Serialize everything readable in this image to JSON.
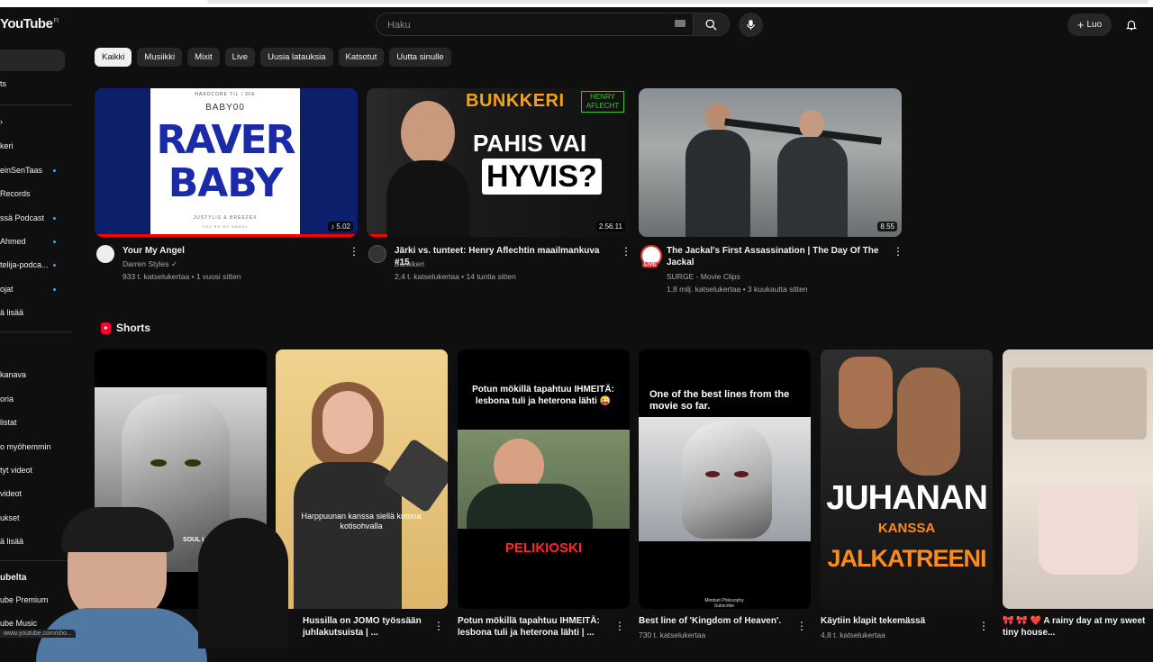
{
  "app": {
    "logo": "YouTube",
    "region": "FI"
  },
  "search": {
    "placeholder": "Haku",
    "value": ""
  },
  "header": {
    "create_label": "Luo"
  },
  "sidebar": {
    "items": [
      {
        "label": "ts"
      },
      {
        "label": "keri"
      },
      {
        "label": "einSenTaas"
      },
      {
        "label": "Records"
      },
      {
        "label": "ssä Podcast"
      },
      {
        "label": "Ahmed"
      },
      {
        "label": "telija-podca..."
      },
      {
        "label": "ojat"
      },
      {
        "label": "ä lisää"
      },
      {
        "label": "kanava"
      },
      {
        "label": "oria"
      },
      {
        "label": "listat"
      },
      {
        "label": "o myöhemmin"
      },
      {
        "label": "tyt videot"
      },
      {
        "label": "videot"
      },
      {
        "label": "ukset"
      },
      {
        "label": "ä lisää"
      },
      {
        "label": "ubelta"
      },
      {
        "label": "ube Premium"
      },
      {
        "label": "ube Music"
      }
    ]
  },
  "chips": [
    "Kaikki",
    "Musiikki",
    "Mixit",
    "Live",
    "Uusia latauksia",
    "Katsotut",
    "Uutta sinulle"
  ],
  "videos": [
    {
      "title": "Your My Angel",
      "channel": "Darren Styles",
      "meta": "933 t. katselukertaa • 1 vuosi sitten",
      "duration": "5.02",
      "progress": 0.99,
      "thumb_text": {
        "top": "HARDCORE TIL I DIE",
        "brand": "BABY00",
        "big1": "RAVER",
        "big2": "BABY",
        "bottom": "JUSTYLIS & BREEZEX",
        "sub": "YOU'RE MY ANGEL"
      }
    },
    {
      "title": "Järki vs. tunteet: Henry Aflechtin maailmankuva #15",
      "channel": "Bunkkeri",
      "meta": "2,4 t. katselukertaa • 14 tuntia sitten",
      "duration": "2.56.11",
      "progress": 0.08,
      "thumb_text": {
        "brand": "BUNKKERI",
        "guest1": "HENRY",
        "guest2": "AFLECHT",
        "line1": "PAHIS VAI",
        "line2": "HYVIS?"
      }
    },
    {
      "title": "The Jackal's First Assassination | The Day Of The Jackal",
      "channel": "SURGE - Movie Clips",
      "meta": "1,8 milj. katselukertaa • 3 kuukautta sitten",
      "duration": "8.55",
      "progress": 0,
      "live_badge": "LIVE"
    }
  ],
  "shorts": {
    "heading": "Shorts",
    "items": [
      {
        "title": "",
        "views": "",
        "overlay": "SOUL I... EPING"
      },
      {
        "title": "Hussilla on JOMO työssään juhlakutsuista | ...",
        "views": "",
        "overlay": "Harppuunan kanssa siellä kotona kotisohvalla"
      },
      {
        "title": "Potun mökillä tapahtuu IHMEITÄ: lesbona tuli ja heterona lähti | ...",
        "views": "",
        "overlay": "Potun mökillä tapahtuu IHMEITÄ: lesbona tuli ja heterona lähti 😜",
        "badge": "PELIKIOSKI"
      },
      {
        "title": "Best line of 'Kingdom of Heaven'.",
        "views": "730 t. katselukertaa",
        "overlay": "One of the best lines from the movie so far.",
        "footer": "Mindset Philosophy Subscribe"
      },
      {
        "title": "Käytiin klapit tekemässä",
        "views": "4,8 t. katselukertaa",
        "overlay1": "JUHANAN",
        "overlay2": "KANSSA",
        "overlay3": "JALKATREENI"
      },
      {
        "title": "🎀 🎀 ❤️ A rainy day at my sweet tiny house...",
        "views": ""
      }
    ]
  },
  "statusbar": {
    "url": "www.youtube.com/sho..."
  },
  "colors": {
    "background": "#0f0f0f",
    "accent": "#ff0000",
    "chip_active": "#f1f1f1",
    "chip": "#272727"
  }
}
